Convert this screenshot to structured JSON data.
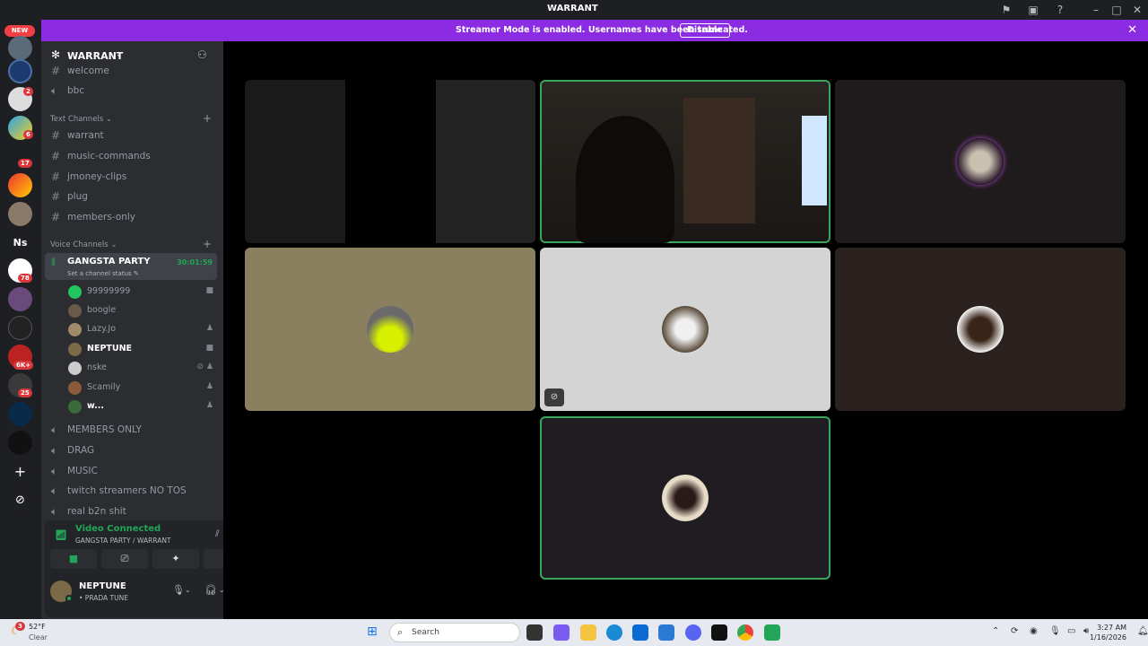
{
  "window": {
    "title": "WARRANT"
  },
  "banner": {
    "message": "Streamer Mode is enabled. Usernames have been truncated.",
    "disable_label": "Disable"
  },
  "server_rail": {
    "new_badge": "NEW",
    "server_text": "Ns",
    "badges": [
      "2",
      "6",
      "17",
      "78",
      "6K+",
      "25"
    ]
  },
  "guild": {
    "name": "WARRANT"
  },
  "channels": {
    "top": [
      {
        "label": "welcome",
        "icon": "hash-icon"
      },
      {
        "label": "bbc",
        "icon": "speaker-icon"
      }
    ],
    "text_category": "Text Channels",
    "text": [
      "warrant",
      "music-commands",
      "jmoney-clips",
      "plug",
      "members-only"
    ],
    "voice_category": "Voice Channels",
    "active_voice": {
      "label": "GANGSTA PARTY",
      "status": "Set a channel status",
      "timer": "30:01:59"
    },
    "members": [
      {
        "name": "99999999",
        "color": "#22c55e",
        "icon": "video-icon"
      },
      {
        "name": "boogle",
        "color": "#6b5a4a",
        "icon": ""
      },
      {
        "name": "Lazy.Jo",
        "color": "#a08a6a",
        "icon": "game-icon"
      },
      {
        "name": "NEPTUNE",
        "color": "#7a6a48",
        "icon": "video-icon"
      },
      {
        "name": "nske",
        "color": "#ccc",
        "icon": "deafen-icon"
      },
      {
        "name": "Scamily",
        "color": "#8a5a3a",
        "icon": "game-icon"
      },
      {
        "name": "w...",
        "color": "#3a6a3a",
        "icon": "game-icon"
      }
    ],
    "voice_other": [
      "MEMBERS ONLY",
      "DRAG",
      "MUSIC",
      "twitch streamers NO TOS",
      "real b2n shit"
    ]
  },
  "voice_panel": {
    "status": "Video Connected",
    "location": "GANGSTA PARTY / WARRANT"
  },
  "user": {
    "name": "NEPTUNE",
    "status": "• PRADA TUNE"
  },
  "taskbar": {
    "weather_temp": "52°F",
    "weather_desc": "Clear",
    "weather_badge": "3",
    "search_label": "Search",
    "time": "3:27 AM",
    "date": "1/16/2026"
  },
  "colors": {
    "accent_banner": "#8b2be2",
    "online": "#23a559",
    "speaking_outline": "#3ba55c"
  }
}
